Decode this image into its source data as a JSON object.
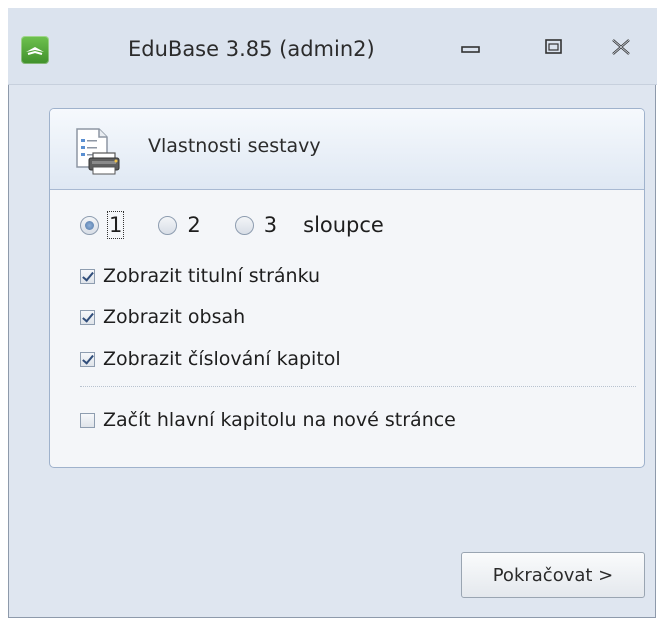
{
  "window": {
    "title": "EduBase 3.85 (admin2)",
    "icon": "edubase-app-icon",
    "controls": {
      "minimize": "minimize-icon",
      "maximize": "maximize-icon",
      "close": "close-icon"
    }
  },
  "panel": {
    "title": "Vlastnosti sestavy",
    "icon": "report-printer-icon",
    "columns": {
      "options": [
        "1",
        "2",
        "3"
      ],
      "selected": "1",
      "label": "sloupce"
    },
    "checkboxes": [
      {
        "label": "Zobrazit titulní stránku",
        "checked": true
      },
      {
        "label": "Zobrazit obsah",
        "checked": true
      },
      {
        "label": "Zobrazit číslování kapitol",
        "checked": true
      },
      {
        "label": "Začít hlavní kapitolu na nové stránce",
        "checked": false
      }
    ]
  },
  "footer": {
    "continue_label": "Pokračovat >"
  }
}
